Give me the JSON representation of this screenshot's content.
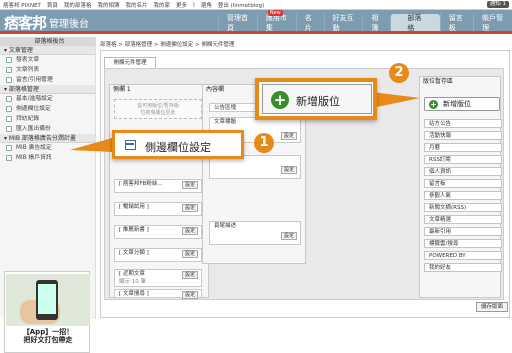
{
  "topbar": {
    "links": [
      "痞客邦 PIXNET",
      "首頁",
      "我的部落格",
      "我的相簿",
      "我的名片",
      "我的家",
      "更多",
      "|",
      "選角",
      "登出 (linmetblog)"
    ],
    "badge": "通知 1"
  },
  "header": {
    "logo": "痞客邦",
    "subtitle": "管理後台",
    "nav": [
      "管理首頁",
      "應用市集",
      "名片",
      "好友互動",
      "相簿",
      "部落格",
      "留言板",
      "帳戶管理"
    ],
    "new_badge": "New",
    "active_nav": "部落格"
  },
  "sidebar": {
    "title": "部落格後台",
    "sections": [
      {
        "label": "文章管理",
        "items": [
          "發表文章",
          "文章列表",
          "留言/引用管理"
        ]
      },
      {
        "label": "部落格管理",
        "items": [
          "基本/進階設定",
          "側邊欄位設定",
          "拜訪紀錄",
          "匯入匯出備份"
        ]
      },
      {
        "label": "MIB 部落格廣告分潤計畫",
        "items": [
          "MIB 廣告設定",
          "MIB 帳戶資訊"
        ]
      }
    ],
    "promo": {
      "line1": "【App】一招！",
      "line2": "把好文打包帶走"
    }
  },
  "breadcrumb": "部落格  >  部落格管理  >  側邊欄位設定  >  側欄元件管理",
  "tab": "側欄元件管理",
  "column1": {
    "title": "側欄 1",
    "ghost_text": [
      "從可用版位/暫存版",
      "位拖曳版位至此"
    ],
    "boxes": [
      "[ 痞客邦FB粉絲...",
      "[ 暢銷試用 ]",
      "[ 推薦新書 ]",
      "[ 文章分類 ]",
      "[ 近期文章",
      "[ 文章搜尋 ]"
    ],
    "sub_texts": [
      "",
      "",
      "",
      "",
      "顯示 10 筆",
      ""
    ],
    "set_label": "設定"
  },
  "column2": {
    "title": "內容欄",
    "boxes": [
      "公告區塊",
      "文章標題",
      "",
      "頁尾描述"
    ],
    "set_label": "設定"
  },
  "column3": {
    "title": "版位暫存區",
    "add_button": "新增版位",
    "items": [
      "站方公告",
      "活動快報",
      "月曆",
      "RSS訂閱",
      "個人資訊",
      "留言板",
      "參觀人氣",
      "新聞文摘(RSS)",
      "文章精選",
      "最新引用",
      "標籤雲/搜尋",
      "POWERED BY",
      "我的好友"
    ]
  },
  "callout_right": {
    "label": "新增版位",
    "number": "2"
  },
  "callout_left": {
    "label": "側邊欄位設定",
    "number": "1"
  },
  "save_button": "儲存版面",
  "colors": {
    "header": "#7e9caf",
    "accent": "#e88a1a",
    "red_line": "#c7472f",
    "green": "#3a8c2f"
  }
}
